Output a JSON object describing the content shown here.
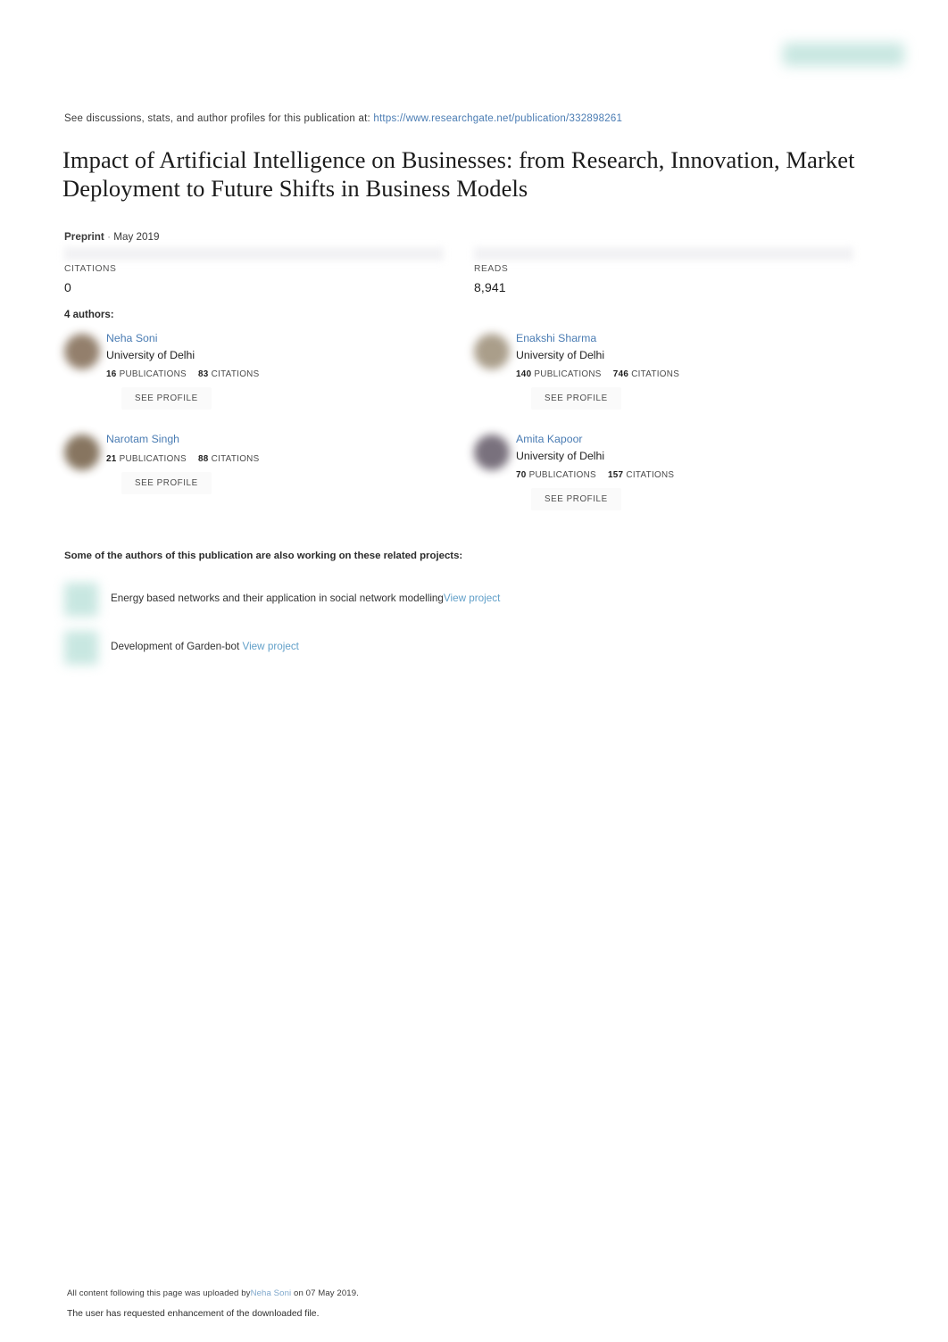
{
  "header": {
    "see_discussions_prefix": "See discussions, stats, and author profiles for this publication at:",
    "publication_url": "https://www.researchgate.net/publication/332898261",
    "logo_name": "researchgate-logo"
  },
  "publication": {
    "title": "Impact of Artificial Intelligence on Businesses: from Research, Innovation, Market Deployment to Future Shifts in Business Models",
    "type": "Preprint",
    "separator": "·",
    "date": "May 2019"
  },
  "stats": {
    "citations_label": "CITATIONS",
    "citations_value": "0",
    "reads_label": "READS",
    "reads_value": "8,941"
  },
  "authors_section": {
    "heading": "4 authors:",
    "see_profile_label": "SEE PROFILE",
    "publications_label": "PUBLICATIONS",
    "citations_label": "CITATIONS",
    "authors": [
      {
        "name": "Neha Soni",
        "affiliation": "University of Delhi",
        "publications": "16",
        "citations": "83",
        "avatar_color": "#8a7560"
      },
      {
        "name": "Enakshi Sharma",
        "affiliation": "University of Delhi",
        "publications": "140",
        "citations": "746",
        "avatar_color": "#a39681"
      },
      {
        "name": "Narotam Singh",
        "affiliation": "",
        "publications": "21",
        "citations": "88",
        "avatar_color": "#7d6a53"
      },
      {
        "name": "Amita Kapoor",
        "affiliation": "University of Delhi",
        "publications": "70",
        "citations": "157",
        "avatar_color": "#6e6572"
      }
    ]
  },
  "projects_section": {
    "heading": "Some of the authors of this publication are also working on these related projects:",
    "view_project_label": "View project",
    "projects": [
      {
        "title": "Energy based networks and their application in social network modelling",
        "space_before_link": false
      },
      {
        "title": "Development of Garden-bot",
        "space_before_link": true
      }
    ]
  },
  "footer": {
    "upload_prefix": "All content following this page was uploaded by",
    "uploader": "Neha Soni",
    "upload_suffix": " on 07 May 2019.",
    "enhancement_note": "The user has requested enhancement of the downloaded file."
  },
  "colors": {
    "link_blue": "#4a7cb3",
    "project_link_blue": "#62a0c9",
    "rg_teal": "#bfe3dc",
    "text_dark": "#222222"
  }
}
